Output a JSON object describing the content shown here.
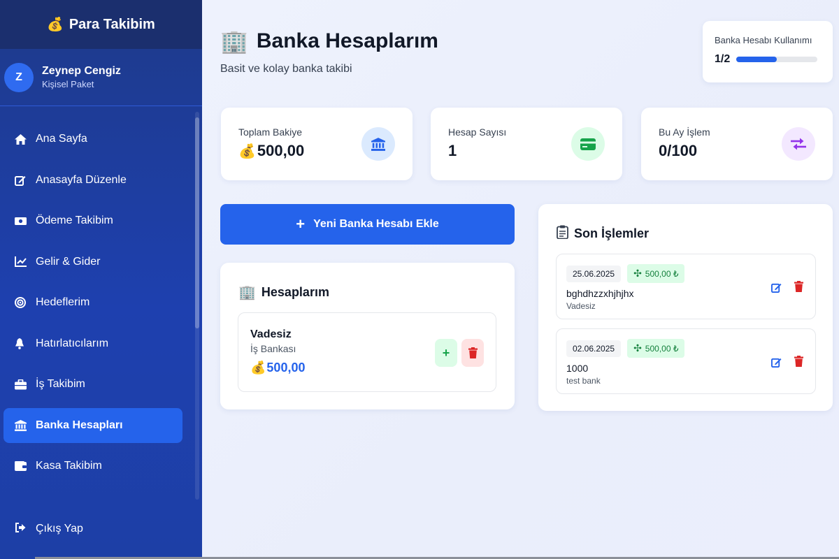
{
  "sidebar": {
    "brand_icon": "money-bag-icon",
    "brand": "Para Takibim",
    "user": {
      "initial": "Z",
      "name": "Zeynep Cengiz",
      "plan": "Kişisel Paket"
    },
    "items": [
      {
        "label": "Ana Sayfa",
        "icon": "home-icon"
      },
      {
        "label": "Anasayfa Düzenle",
        "icon": "edit-icon"
      },
      {
        "label": "Ödeme Takibim",
        "icon": "cash-icon"
      },
      {
        "label": "Gelir & Gider",
        "icon": "chart-line-icon"
      },
      {
        "label": "Hedeflerim",
        "icon": "target-icon"
      },
      {
        "label": "Hatırlatıcılarım",
        "icon": "bell-icon"
      },
      {
        "label": "İş Takibim",
        "icon": "briefcase-icon"
      },
      {
        "label": "Banka Hesapları",
        "icon": "bank-icon",
        "active": true
      },
      {
        "label": "Kasa Takibim",
        "icon": "wallet-icon"
      }
    ],
    "logout": "Çıkış Yap"
  },
  "header": {
    "title": "Banka Hesaplarım",
    "subtitle": "Basit ve kolay banka takibi"
  },
  "usage": {
    "label": "Banka Hesabı Kullanımı",
    "count": "1/2",
    "fraction": 0.5
  },
  "stats": [
    {
      "label": "Toplam Bakiye",
      "value": "500,00",
      "icon": "bank-icon",
      "color": "#2563eb",
      "bg": "#dbeafe"
    },
    {
      "label": "Hesap Sayısı",
      "value": "1",
      "icon": "credit-card-icon",
      "color": "#16a34a",
      "bg": "#dcfce7"
    },
    {
      "label": "Bu Ay İşlem",
      "value": "0/100",
      "icon": "exchange-icon",
      "color": "#9333ea",
      "bg": "#f3e8ff"
    }
  ],
  "add_button": "Yeni Banka Hesabı Ekle",
  "accounts_card": {
    "title": "Hesaplarım",
    "accounts": [
      {
        "name": "Vadesiz",
        "bank": "İş Bankası",
        "balance": "500,00"
      }
    ]
  },
  "transactions_card": {
    "title": "Son İşlemler",
    "items": [
      {
        "date": "25.06.2025",
        "amount": "500,00 ₺",
        "desc": "bghdhzzxhjhjhx",
        "account": "Vadesiz"
      },
      {
        "date": "02.06.2025",
        "amount": "500,00 ₺",
        "desc": "1000",
        "account": "test bank"
      }
    ]
  }
}
